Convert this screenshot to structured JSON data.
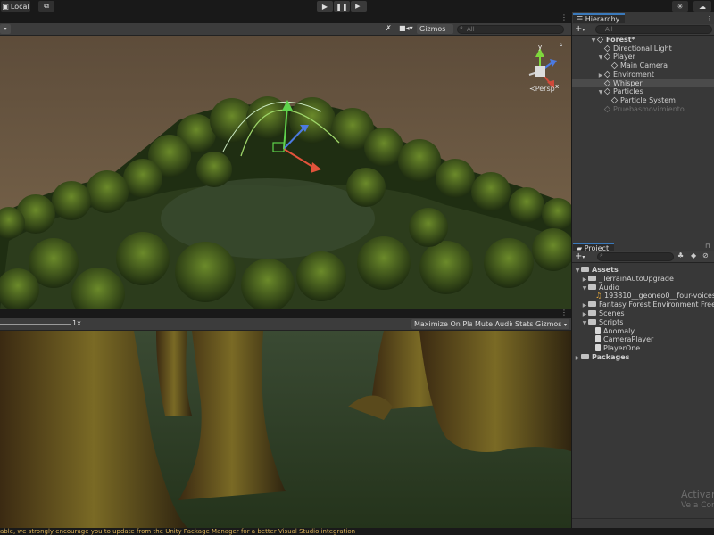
{
  "toolbar": {
    "local_label": "Local",
    "play_icon": "play-icon",
    "pause_icon": "pause-icon",
    "step_icon": "step-icon"
  },
  "scene": {
    "gizmos_label": "Gizmos",
    "search_placeholder": "All",
    "persp_label": "Persp",
    "axis_y": "y",
    "axis_x": "x"
  },
  "game": {
    "scale_value": "1x",
    "maximize_label": "Maximize On Play",
    "mute_label": "Mute Audio",
    "stats_label": "Stats",
    "gizmos_label": "Gizmos"
  },
  "hierarchy": {
    "tab_label": "Hierarchy",
    "search_placeholder": "All",
    "items": [
      {
        "label": "Forest*"
      },
      {
        "label": "Directional Light"
      },
      {
        "label": "Player"
      },
      {
        "label": "Main Camera"
      },
      {
        "label": "Enviroment"
      },
      {
        "label": "Whisper"
      },
      {
        "label": "Particles"
      },
      {
        "label": "Particle System"
      },
      {
        "label": "Pruebasmovimiento"
      }
    ]
  },
  "project": {
    "tab_label": "Project",
    "items": [
      {
        "label": "Assets"
      },
      {
        "label": "_TerrainAutoUpgrade"
      },
      {
        "label": "Audio"
      },
      {
        "label": "193810__geoneo0__four-voices-wh"
      },
      {
        "label": "Fantasy Forest Environment Free Samp"
      },
      {
        "label": "Scenes"
      },
      {
        "label": "Scripts"
      },
      {
        "label": "Anomaly"
      },
      {
        "label": "CameraPlayer"
      },
      {
        "label": "PlayerOne"
      },
      {
        "label": "Packages"
      }
    ]
  },
  "status": {
    "message": "able, we strongly encourage you to update from the Unity Package Manager for a better Visual Studio integration"
  },
  "watermark": {
    "line1": "Activar",
    "line2": "Ve a Confi"
  },
  "colors": {
    "accent": "#3a79bb",
    "status_text": "#d8b05a",
    "selection": "#4b4b4b"
  }
}
